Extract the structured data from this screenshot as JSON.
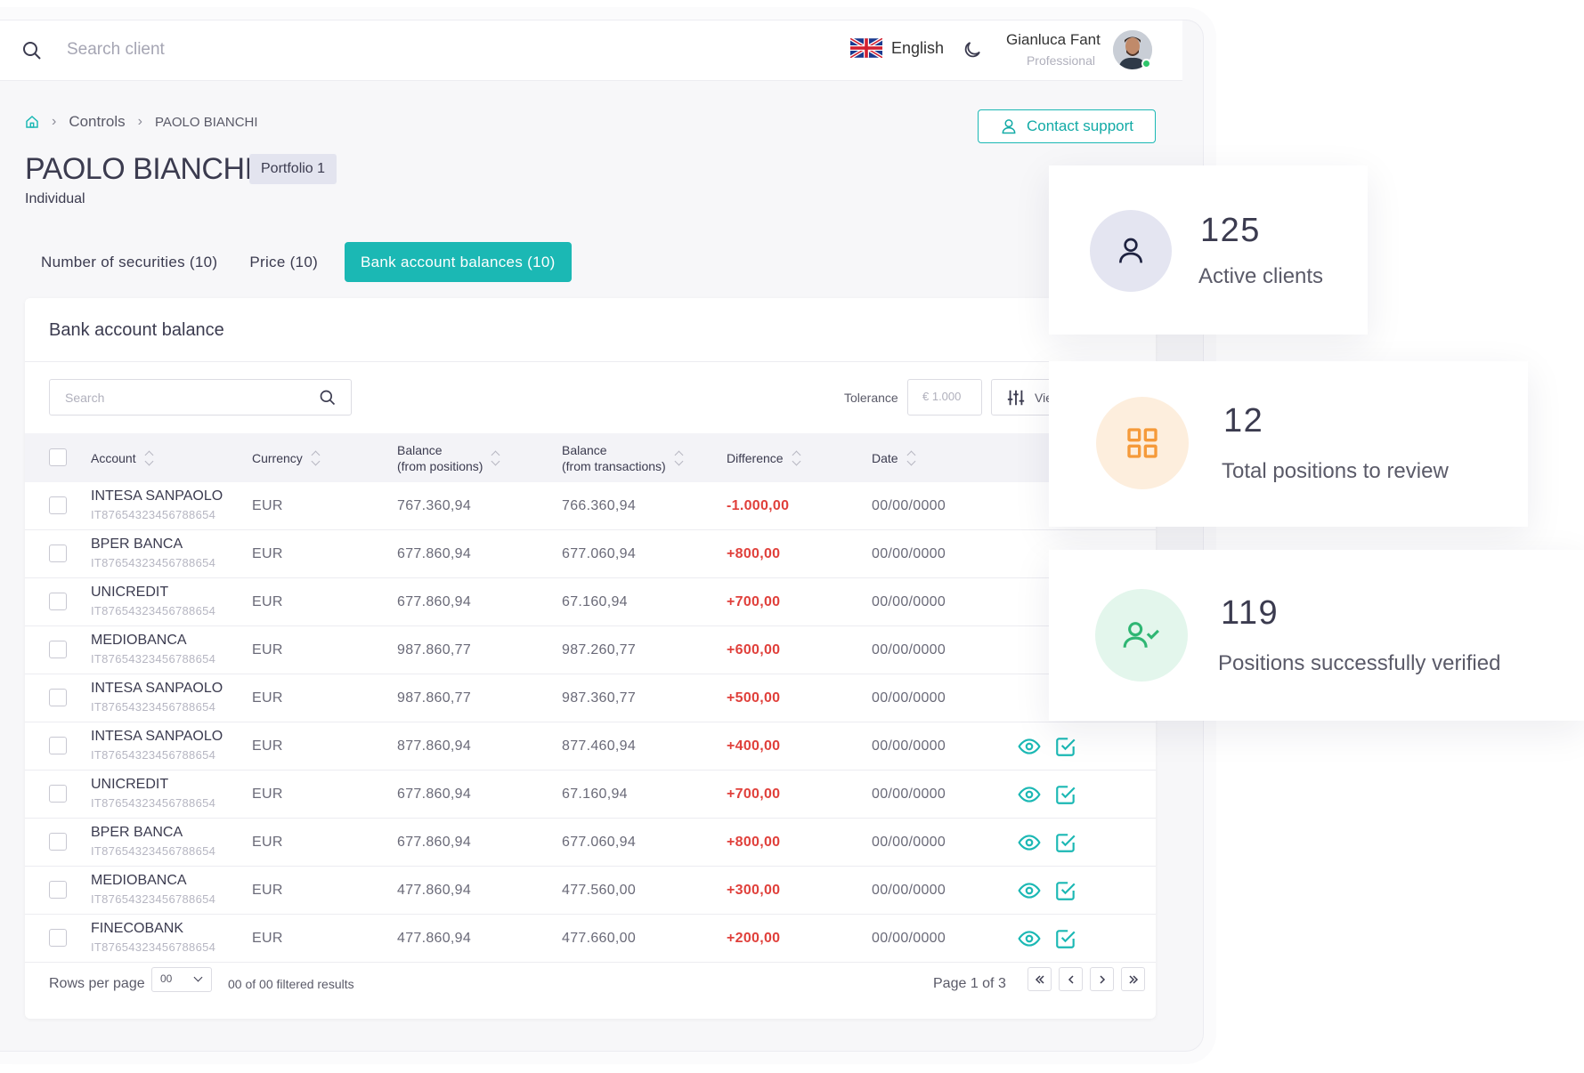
{
  "topbar": {
    "search_placeholder": "Search client",
    "language": "English",
    "user_name": "Gianluca Fant",
    "user_role": "Professional"
  },
  "breadcrumb": [
    "Controls",
    "PAOLO BIANCHI"
  ],
  "contact_support": "Contact support",
  "client": {
    "name": "PAOLO BIANCHI",
    "portfolio": "Portfolio 1",
    "type": "Individual"
  },
  "tabs": [
    {
      "label": "Number of securities (10)"
    },
    {
      "label": "Price (10)"
    },
    {
      "label": "Bank account balances (10)"
    }
  ],
  "card": {
    "title": "Bank account balance",
    "search_placeholder": "Search",
    "tolerance_label": "Tolerance",
    "tolerance_placeholder": "€ 1.000",
    "view_label": "Vie"
  },
  "columns": {
    "account": "Account",
    "currency": "Currency",
    "balance_pos_1": "Balance",
    "balance_pos_2": "(from positions)",
    "balance_tx_1": "Balance",
    "balance_tx_2": "(from transactions)",
    "difference": "Difference",
    "date": "Date"
  },
  "rows": [
    {
      "account": "INTESA SANPAOLO",
      "iban": "IT87654323456788654",
      "currency": "EUR",
      "bal_pos": "767.360,94",
      "bal_tx": "766.360,94",
      "diff": "-1.000,00",
      "date": "00/00/0000",
      "actions": false
    },
    {
      "account": "BPER BANCA",
      "iban": "IT87654323456788654",
      "currency": "EUR",
      "bal_pos": "677.860,94",
      "bal_tx": "677.060,94",
      "diff": "+800,00",
      "date": "00/00/0000",
      "actions": false
    },
    {
      "account": "UNICREDIT",
      "iban": "IT87654323456788654",
      "currency": "EUR",
      "bal_pos": "677.860,94",
      "bal_tx": "67.160,94",
      "diff": "+700,00",
      "date": "00/00/0000",
      "actions": false
    },
    {
      "account": "MEDIOBANCA",
      "iban": "IT87654323456788654",
      "currency": "EUR",
      "bal_pos": "987.860,77",
      "bal_tx": "987.260,77",
      "diff": "+600,00",
      "date": "00/00/0000",
      "actions": false
    },
    {
      "account": "INTESA SANPAOLO",
      "iban": "IT87654323456788654",
      "currency": "EUR",
      "bal_pos": "987.860,77",
      "bal_tx": "987.360,77",
      "diff": "+500,00",
      "date": "00/00/0000",
      "actions": false
    },
    {
      "account": "INTESA SANPAOLO",
      "iban": "IT87654323456788654",
      "currency": "EUR",
      "bal_pos": "877.860,94",
      "bal_tx": "877.460,94",
      "diff": "+400,00",
      "date": "00/00/0000",
      "actions": true
    },
    {
      "account": "UNICREDIT",
      "iban": "IT87654323456788654",
      "currency": "EUR",
      "bal_pos": "677.860,94",
      "bal_tx": "67.160,94",
      "diff": "+700,00",
      "date": "00/00/0000",
      "actions": true
    },
    {
      "account": "BPER BANCA",
      "iban": "IT87654323456788654",
      "currency": "EUR",
      "bal_pos": "677.860,94",
      "bal_tx": "677.060,94",
      "diff": "+800,00",
      "date": "00/00/0000",
      "actions": true
    },
    {
      "account": "MEDIOBANCA",
      "iban": "IT87654323456788654",
      "currency": "EUR",
      "bal_pos": "477.860,94",
      "bal_tx": "477.560,00",
      "diff": "+300,00",
      "date": "00/00/0000",
      "actions": true
    },
    {
      "account": "FINECOBANK",
      "iban": "IT87654323456788654",
      "currency": "EUR",
      "bal_pos": "477.860,94",
      "bal_tx": "477.660,00",
      "diff": "+200,00",
      "date": "00/00/0000",
      "actions": true
    }
  ],
  "footer": {
    "rows_per_page": "Rows per page",
    "rows_value": "00",
    "results": "00 of 00 filtered results",
    "page": "Page 1 of 3"
  },
  "stats": [
    {
      "value": "125",
      "label": "Active clients",
      "icon": "user-icon"
    },
    {
      "value": "12",
      "label": "Total positions to review",
      "icon": "grid-icon"
    },
    {
      "value": "119",
      "label": "Positions successfully verified",
      "icon": "user-check-icon"
    }
  ],
  "colors": {
    "accent": "#1bb8b4",
    "negative": "#e0403b",
    "stat_1_bg": "#e4e5f1",
    "stat_2_bg": "#fdeedd",
    "stat_3_bg": "#e3f6ec"
  }
}
